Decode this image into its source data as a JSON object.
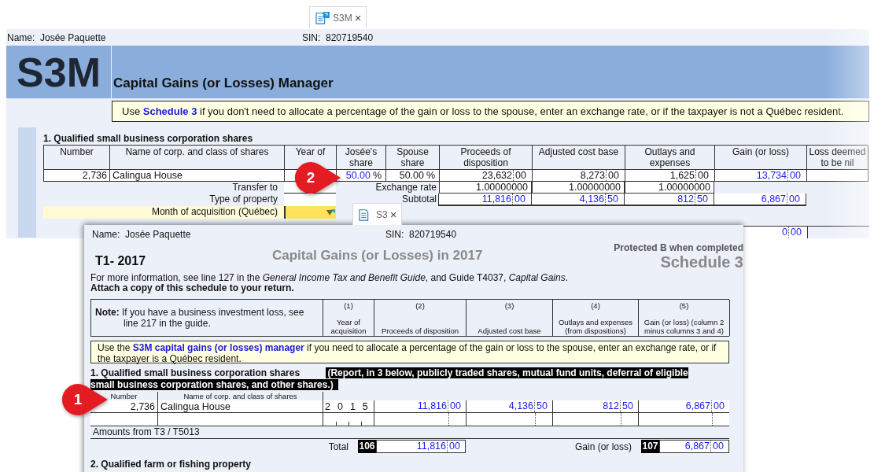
{
  "top_window": {
    "tab": {
      "label": "S3M",
      "close": "×",
      "selected": true
    },
    "name_label": "Name:",
    "name": "Josée Paquette",
    "sin_label": "SIN:",
    "sin": "820719540",
    "form_code": "S3M",
    "title": "Capital Gains (or Losses) Manager",
    "note": {
      "before": "Use",
      "link": "Schedule 3",
      "after": "if you don't need to allocate a percentage of the gain or loss to the spouse, enter an exchange rate, or if the taxpayer is not a Québec resident."
    },
    "section_title": "1. Qualified small business corporation shares",
    "columns": [
      "Number",
      "Name of corp. and class of shares",
      "Year of",
      "Josée's share",
      "Spouse share",
      "Proceeds of disposition",
      "Adjusted cost base",
      "Outlays and expenses",
      "Gain (or loss)",
      "Loss deemed to be nil"
    ],
    "row": [
      {
        "kind": "number",
        "text": "2,736"
      },
      {
        "kind": "text",
        "text": "Calingua House"
      },
      {
        "kind": "empty"
      },
      {
        "kind": "percent",
        "text": "50.00",
        "unit": "%",
        "computed": true
      },
      {
        "kind": "percent",
        "text": "50.00",
        "unit": "%",
        "computed": false
      },
      {
        "kind": "amount",
        "dollars": "23,632",
        "cents": "00",
        "computed": false
      },
      {
        "kind": "amount",
        "dollars": "8,273",
        "cents": "00",
        "computed": false
      },
      {
        "kind": "amount",
        "dollars": "1,625",
        "cents": "00",
        "computed": false
      },
      {
        "kind": "amount",
        "dollars": "13,734",
        "cents": "00",
        "computed": true
      },
      {
        "kind": "empty"
      }
    ],
    "fields": [
      {
        "label": "Transfer to",
        "kind": "line",
        "focused": false
      },
      {
        "label": "Type of property",
        "kind": "box",
        "focused": false
      },
      {
        "label": "Month of acquisition (Québec)",
        "kind": "dropdown",
        "focused": true
      }
    ],
    "exchange_rate": {
      "label": "Exchange rate",
      "values": [
        "1.00000000",
        "1.00000000",
        "1.00000000"
      ]
    },
    "subtotal": {
      "label": "Subtotal",
      "values": [
        {
          "dollars": "11,816",
          "cents": "00",
          "computed": true
        },
        {
          "dollars": "4,136",
          "cents": "50",
          "computed": true
        },
        {
          "dollars": "812",
          "cents": "50",
          "computed": true
        },
        {
          "dollars": "6,867",
          "cents": "00",
          "computed": true
        }
      ]
    },
    "next_row_gain": {
      "dollars": "0",
      "cents": "00",
      "computed": true
    }
  },
  "bottom_window": {
    "tab": {
      "label": "S3",
      "close": "×",
      "selected": true
    },
    "name_label": "Name:",
    "name": "Josée Paquette",
    "sin_label": "SIN:",
    "sin": "820719540",
    "form_id": "T1- 2017",
    "title": "Capital Gains (or Losses) in 2017",
    "protected": "Protected B when completed",
    "schedule": "Schedule 3",
    "info": "For more information, see line 127 in the *General Income Tax and Benefit Guide*, and Guide T4037, *Capital Gains*.",
    "attach": "Attach a copy of this schedule to your return.",
    "note": "**Note:** If you have a business investment loss, see line 217 in the guide.",
    "columns": [
      {
        "number": "(1)",
        "label": "Year of acquisition"
      },
      {
        "number": "(2)",
        "label": "Proceeds of disposition"
      },
      {
        "number": "(3)",
        "label": "Adjusted cost base"
      },
      {
        "number": "(4)",
        "label": "Outlays and expenses (from dispositions)"
      },
      {
        "number": "(5)",
        "label": "Gain (or loss) (column 2 minus columns 3 and 4)"
      }
    ],
    "manager_note": {
      "before": "Use the",
      "link": "S3M capital gains (or losses) manager",
      "after": "if you need to allocate a percentage of the gain or loss to the spouse, enter an exchange rate, or if the taxpayer is a Québec resident."
    },
    "section_title": "1. Qualified small business corporation shares",
    "section_note": "(Report, in 3 below, publicly traded shares, mutual fund units, deferral of eligible small business corporation shares, and other shares.)",
    "sub_headers": [
      "Number",
      "Name of corp. and class of shares"
    ],
    "row": {
      "number": "2,736",
      "name": "Calingua House",
      "year": "2015",
      "amounts": [
        {
          "dollars": "11,816",
          "cents": "00",
          "computed": true
        },
        {
          "dollars": "4,136",
          "cents": "50",
          "computed": true
        },
        {
          "dollars": "812",
          "cents": "50",
          "computed": true
        },
        {
          "dollars": "6,867",
          "cents": "00",
          "computed": true
        }
      ]
    },
    "amounts_label": "Amounts from T3 / T5013",
    "total": {
      "label": "Total",
      "code": "106",
      "amount": {
        "dollars": "11,816",
        "cents": "00",
        "computed": true
      }
    },
    "gain": {
      "label": "Gain (or loss)",
      "code": "107",
      "amount": {
        "dollars": "6,867",
        "cents": "00",
        "computed": true
      }
    },
    "section2_title": "2. Qualified farm or fishing property"
  },
  "callouts": [
    {
      "text": "1"
    },
    {
      "text": "2"
    }
  ]
}
